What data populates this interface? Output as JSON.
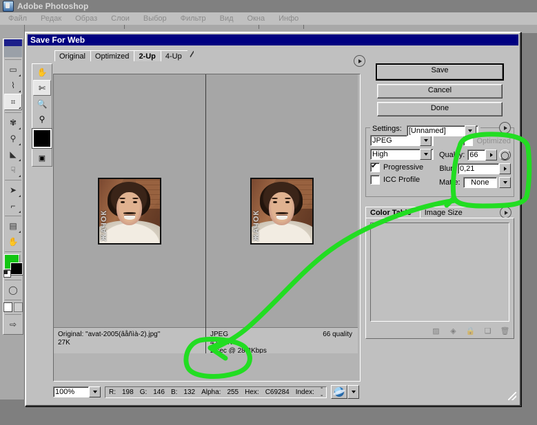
{
  "app": {
    "title": "Adobe Photoshop",
    "icon": "photoshop-icon",
    "menu": [
      "Файл",
      "Редак",
      "Образ",
      "Слои",
      "Выбор",
      "Фильтр",
      "Вид",
      "Окна",
      "Инфо"
    ]
  },
  "toolbox": {
    "tools": [
      {
        "name": "marquee-tool",
        "glyph": "▭"
      },
      {
        "name": "lasso-tool",
        "glyph": "⌇"
      },
      {
        "name": "crop-tool",
        "glyph": "⌗",
        "selected": true
      },
      {
        "name": "healing-brush-tool",
        "glyph": "✿"
      },
      {
        "name": "clone-stamp-tool",
        "glyph": "⚲"
      },
      {
        "name": "eraser-tool",
        "glyph": "◢"
      },
      {
        "name": "blur-tool",
        "glyph": "☟"
      },
      {
        "name": "path-selection-tool",
        "glyph": "➤"
      },
      {
        "name": "pen-tool",
        "glyph": "✒"
      },
      {
        "name": "notes-tool",
        "glyph": "🗎"
      },
      {
        "name": "hand-tool",
        "glyph": "✋"
      }
    ],
    "foreground_color": "#12c512",
    "background_color": "#000000"
  },
  "dialog": {
    "title": "Save For Web",
    "tabs": [
      {
        "label": "Original",
        "selected": false
      },
      {
        "label": "Optimized",
        "selected": false
      },
      {
        "label": "2-Up",
        "selected": true
      },
      {
        "label": "4-Up",
        "selected": false
      }
    ],
    "tools": [
      {
        "name": "hand-tool",
        "glyph": "✋",
        "selected": false
      },
      {
        "name": "slice-select-tool",
        "glyph": "✂",
        "selected": true
      },
      {
        "name": "zoom-tool",
        "glyph": "🔍",
        "selected": false
      },
      {
        "name": "eyedropper-tool",
        "glyph": "⚲",
        "selected": false
      }
    ],
    "buttons": {
      "save": "Save",
      "cancel": "Cancel",
      "done": "Done"
    },
    "settings": {
      "legend": "Settings:",
      "preset": "[Unnamed]",
      "format": "JPEG",
      "quality_preset": "High",
      "progressive": {
        "label": "Progressive",
        "checked": true
      },
      "icc_profile": {
        "label": "ICC Profile",
        "checked": false
      },
      "optimized": {
        "label": "Optimized",
        "checked": false
      },
      "quality": {
        "label": "Quality:",
        "value": "66"
      },
      "blur": {
        "label": "Blur:",
        "value": "0,21"
      },
      "matte": {
        "label": "Matte:",
        "value": "None"
      }
    },
    "color_table": {
      "tabs": [
        {
          "label": "Color Table",
          "selected": true
        },
        {
          "label": "Image Size",
          "selected": false
        }
      ],
      "footer_icons": [
        "transparency-icon",
        "web-snap-icon",
        "lock-icon",
        "new-color-icon",
        "trash-icon"
      ]
    },
    "panes": {
      "original": {
        "line1": "Original: \"avat-2005(ãåñìà-2).jpg\"",
        "line2": "27K",
        "photo_overlay_text": "ЖАЧОК"
      },
      "optimized": {
        "line1": "JPEG",
        "line2": "4,016K",
        "line3": "2 sec @ 28.8Kbps",
        "quality_note": "66 quality",
        "photo_overlay_text": "ЖАЧОК"
      }
    },
    "status": {
      "zoom": "100%",
      "readout": [
        {
          "label": "R:",
          "value": "198"
        },
        {
          "label": "G:",
          "value": "146"
        },
        {
          "label": "B:",
          "value": "132"
        },
        {
          "label": "Alpha:",
          "value": "255"
        },
        {
          "label": "Hex:",
          "value": "C69284"
        },
        {
          "label": "Index:",
          "value": "--"
        }
      ],
      "browser_icon": "internet-explorer-icon"
    }
  },
  "annotation": {
    "color": "#22dd22",
    "description": "hand-drawn-arrow-and-circles"
  }
}
